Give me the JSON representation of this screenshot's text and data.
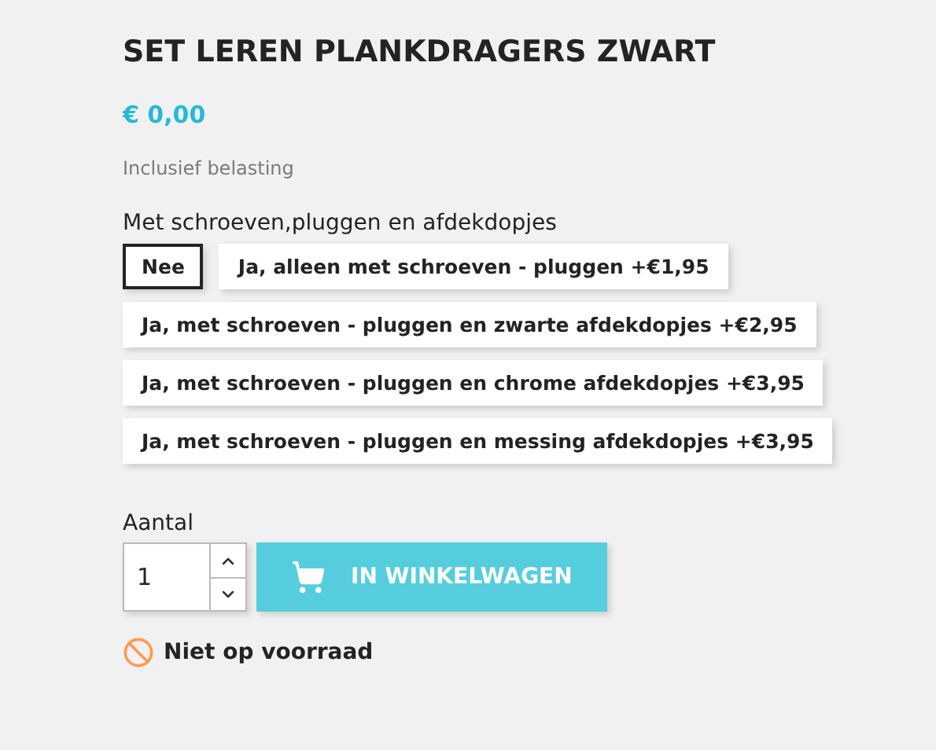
{
  "product": {
    "title": "SET LEREN PLANKDRAGERS ZWART",
    "price": "€ 0,00",
    "tax_note": "Inclusief belasting"
  },
  "variant_group": {
    "label": "Met schroeven,pluggen en afdekdopjes",
    "options": [
      {
        "label": "Nee",
        "selected": true
      },
      {
        "label": "Ja, alleen met schroeven - pluggen +€1,95",
        "selected": false
      },
      {
        "label": "Ja, met schroeven - pluggen en zwarte afdekdopjes +€2,95",
        "selected": false
      },
      {
        "label": "Ja, met schroeven - pluggen en chrome afdekdopjes +€3,95",
        "selected": false
      },
      {
        "label": "Ja, met schroeven - pluggen en messing afdekdopjes +€3,95",
        "selected": false
      }
    ]
  },
  "quantity": {
    "label": "Aantal",
    "value": "1"
  },
  "add_to_cart": {
    "label": "IN WINKELWAGEN"
  },
  "availability": {
    "label": "Niet op voorraad",
    "in_stock": false
  }
}
